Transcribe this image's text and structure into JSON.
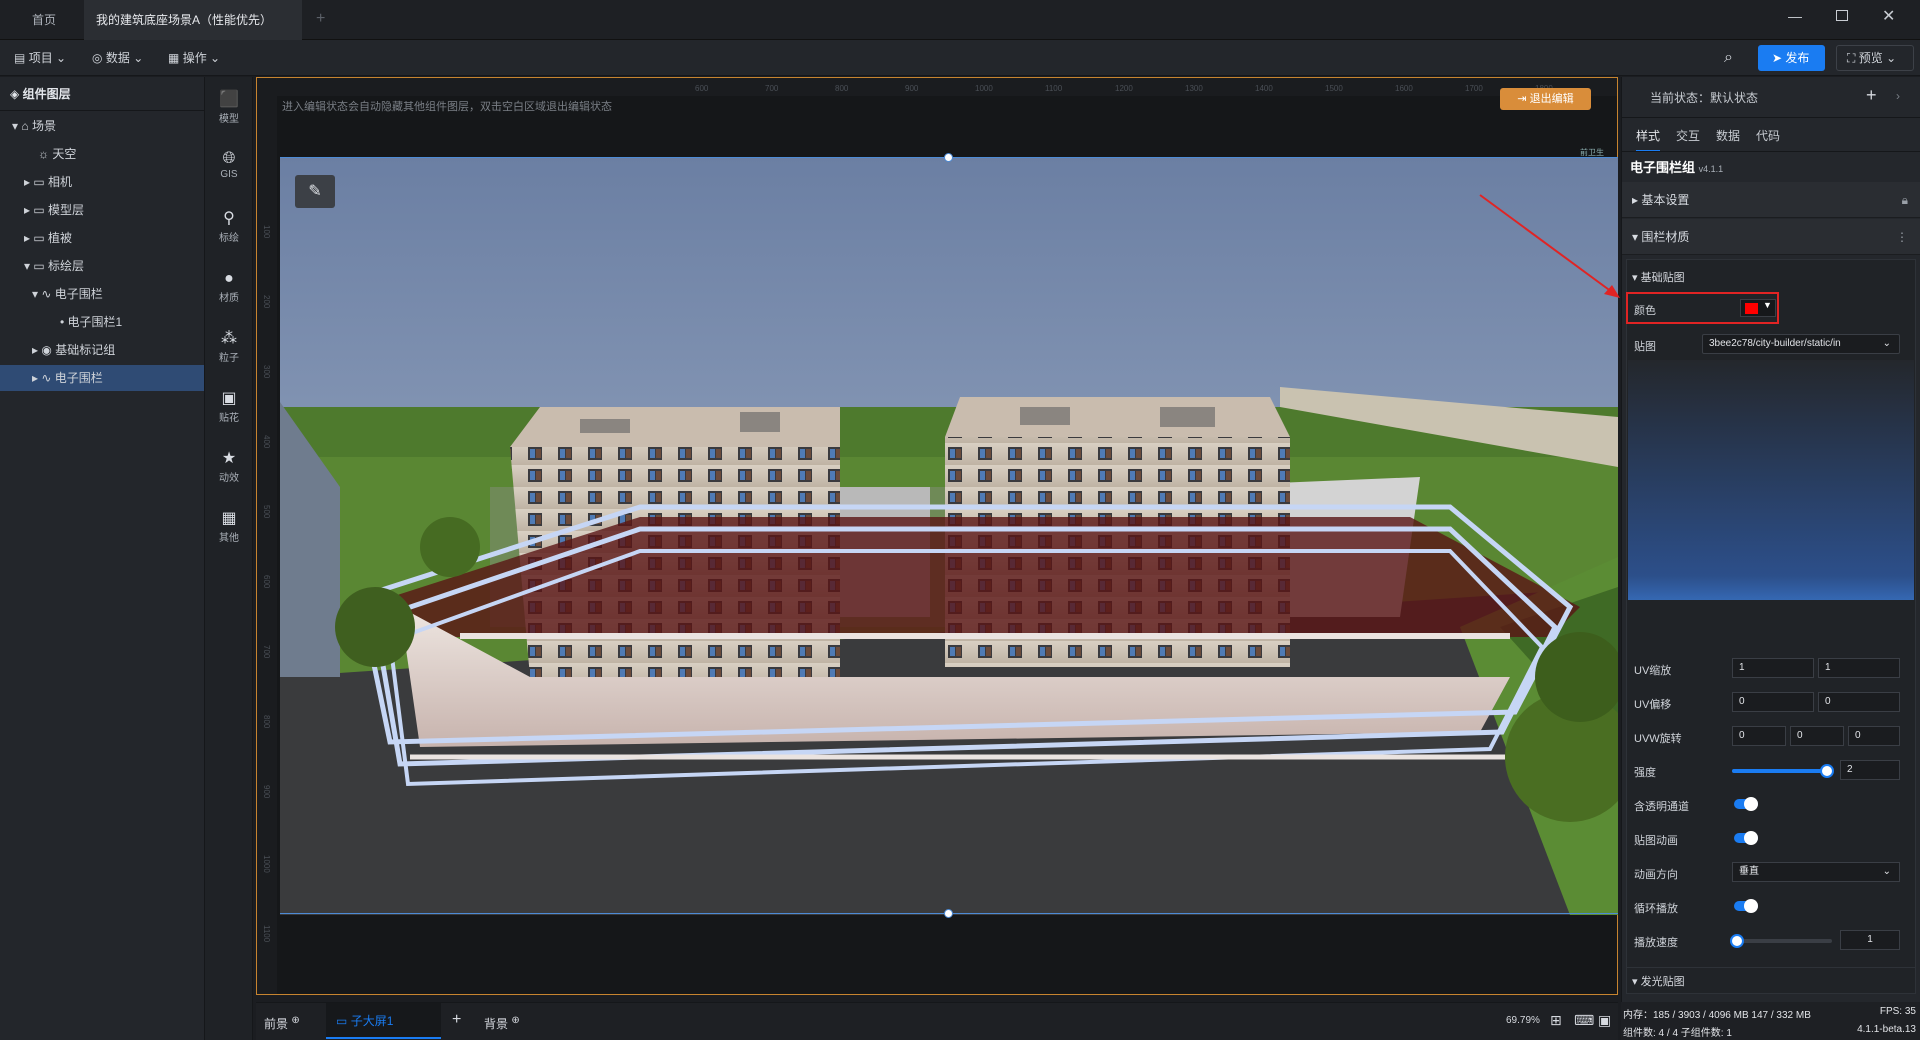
{
  "titlebar": {
    "tabs": [
      {
        "label": "首页"
      },
      {
        "label": "我的建筑底座场景A（性能优先）"
      }
    ]
  },
  "toolbar": {
    "menus": [
      {
        "label": "项目",
        "icon": "file-icon"
      },
      {
        "label": "数据",
        "icon": "database-icon"
      },
      {
        "label": "操作",
        "icon": "grid-icon"
      }
    ],
    "publish_label": "发布",
    "preview_label": "预览"
  },
  "layers": {
    "header": "组件图层",
    "items": [
      {
        "label": "场景"
      },
      {
        "label": "天空"
      },
      {
        "label": "相机"
      },
      {
        "label": "模型层"
      },
      {
        "label": "植被"
      },
      {
        "label": "标绘层"
      },
      {
        "label": "电子围栏"
      },
      {
        "label": "电子围栏1"
      },
      {
        "label": "基础标记组"
      },
      {
        "label": "电子围栏"
      }
    ]
  },
  "iconbar": [
    {
      "label": "模型",
      "icon": "model-icon"
    },
    {
      "label": "GIS",
      "icon": "globe-icon"
    },
    {
      "label": "标绘",
      "icon": "pin-icon"
    },
    {
      "label": "材质",
      "icon": "sphere-icon"
    },
    {
      "label": "粒子",
      "icon": "particle-icon"
    },
    {
      "label": "贴花",
      "icon": "decal-icon"
    },
    {
      "label": "动效",
      "icon": "star-icon"
    },
    {
      "label": "其他",
      "icon": "apps-icon"
    }
  ],
  "canvas": {
    "hint": "进入编辑状态会自动隐藏其他组件图层，双击空白区域退出编辑状态",
    "exit_label": "退出编辑",
    "ruler_top": [
      "600",
      "700",
      "800",
      "900",
      "1000",
      "1100",
      "1200",
      "1300",
      "1400",
      "1500",
      "1600",
      "1700",
      "1800"
    ],
    "ruler_left": [
      "100",
      "200",
      "300",
      "400",
      "500",
      "600",
      "700",
      "800",
      "900",
      "1000",
      "1100"
    ],
    "corner_tag": "前卫生"
  },
  "bottombar": {
    "front_label": "前景",
    "screen_label": "子大屏1",
    "background_label": "背景",
    "zoom": "69.79%"
  },
  "inspector": {
    "state_label": "当前状态：默认状态",
    "tabs": [
      {
        "label": "样式"
      },
      {
        "label": "交互"
      },
      {
        "label": "数据"
      },
      {
        "label": "代码"
      }
    ],
    "component_title": "电子围栏组",
    "version": "v4.1.1",
    "section_basic": "基本设置",
    "section_material": "围栏材质",
    "sub_basic_texture": "基础贴图",
    "color_label": "颜色",
    "color_value": "#ff0000",
    "texture_label": "贴图",
    "texture_value": "3bee2c78/city-builder/static/in",
    "uv_scale_label": "UV缩放",
    "uv_scale": [
      "1",
      "1"
    ],
    "uv_offset_label": "UV偏移",
    "uv_offset": [
      "0",
      "0"
    ],
    "uvw_rotate_label": "UVW旋转",
    "uvw_rotate": [
      "0",
      "0",
      "0"
    ],
    "strength_label": "强度",
    "strength_value": "2",
    "strength_fraction": 0.95,
    "alpha_label": "含透明通道",
    "anim_label": "贴图动画",
    "direction_label": "动画方向",
    "direction_value": "垂直",
    "loop_label": "循环播放",
    "speed_label": "播放速度",
    "speed_value": "1",
    "speed_fraction": 0.02,
    "sub_glow_texture": "发光贴图"
  },
  "status": {
    "memory": "内存：185 / 3903 / 4096 MB  147 / 332 MB",
    "fps": "FPS:  35",
    "components": "组件数: 4 / 4   子组件数: 1",
    "version": "4.1.1-beta.13"
  },
  "colors": {
    "accent": "#1a7cf2",
    "canvas_border": "#c7842f",
    "highlight_box": "#e02424"
  }
}
